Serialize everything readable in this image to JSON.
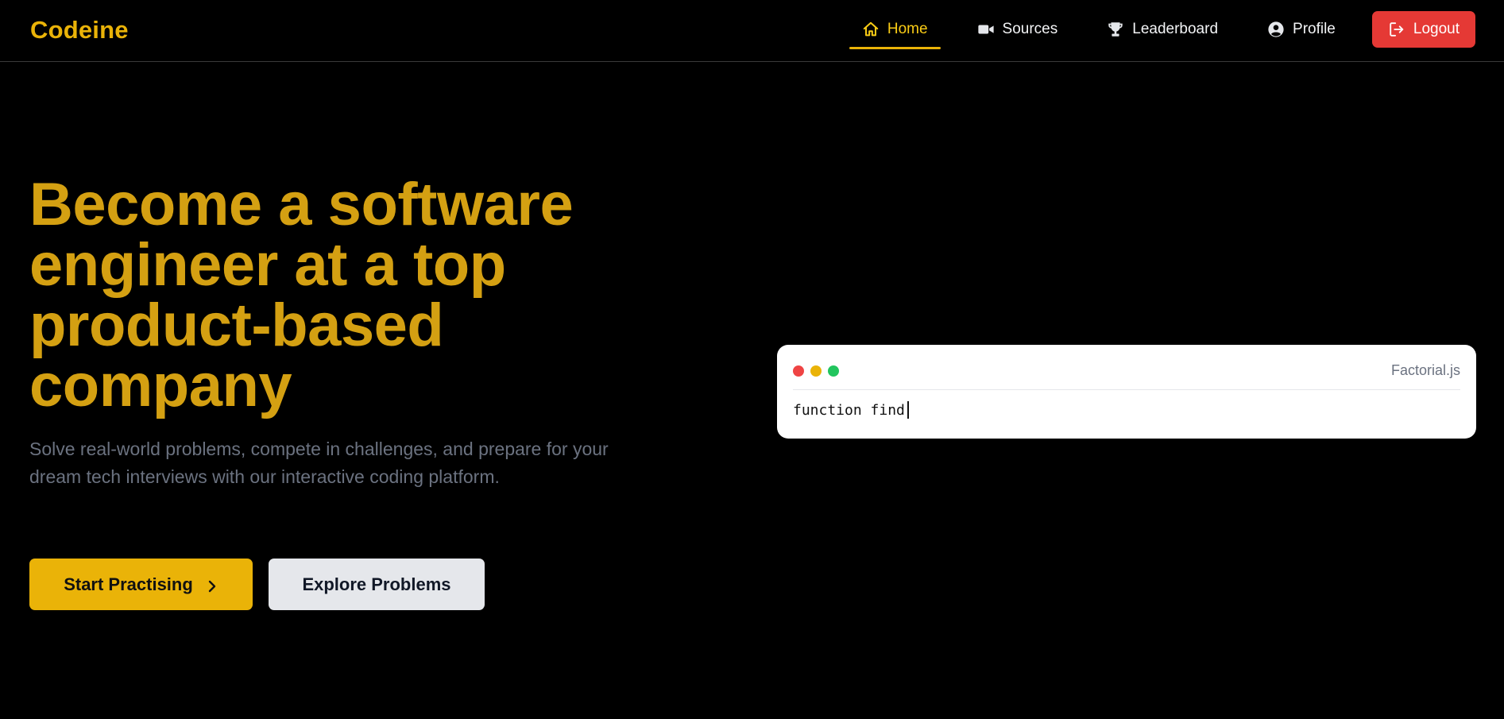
{
  "brand": {
    "name": "Codeine",
    "color": "#eab308"
  },
  "nav": {
    "items": [
      {
        "label": "Home",
        "icon": "home-icon",
        "active": true
      },
      {
        "label": "Sources",
        "icon": "video-camera-icon",
        "active": false
      },
      {
        "label": "Leaderboard",
        "icon": "trophy-icon",
        "active": false
      },
      {
        "label": "Profile",
        "icon": "user-circle-icon",
        "active": false
      }
    ],
    "logout": {
      "label": "Logout",
      "icon": "logout-icon",
      "color": "#e53935"
    }
  },
  "hero": {
    "title_lines": [
      "Become a software",
      "engineer at a top",
      "product-based",
      "company"
    ],
    "subtitle": "Solve real-world problems, compete in challenges, and prepare for your dream tech interviews with our interactive coding platform.",
    "primary_button": {
      "label": "Start Practising",
      "icon": "chevron-right-icon"
    },
    "secondary_button": {
      "label": "Explore Problems"
    }
  },
  "code_card": {
    "filename": "Factorial.js",
    "code": "function find",
    "dot_colors": [
      "#ef4444",
      "#eab308",
      "#22c55e"
    ]
  }
}
